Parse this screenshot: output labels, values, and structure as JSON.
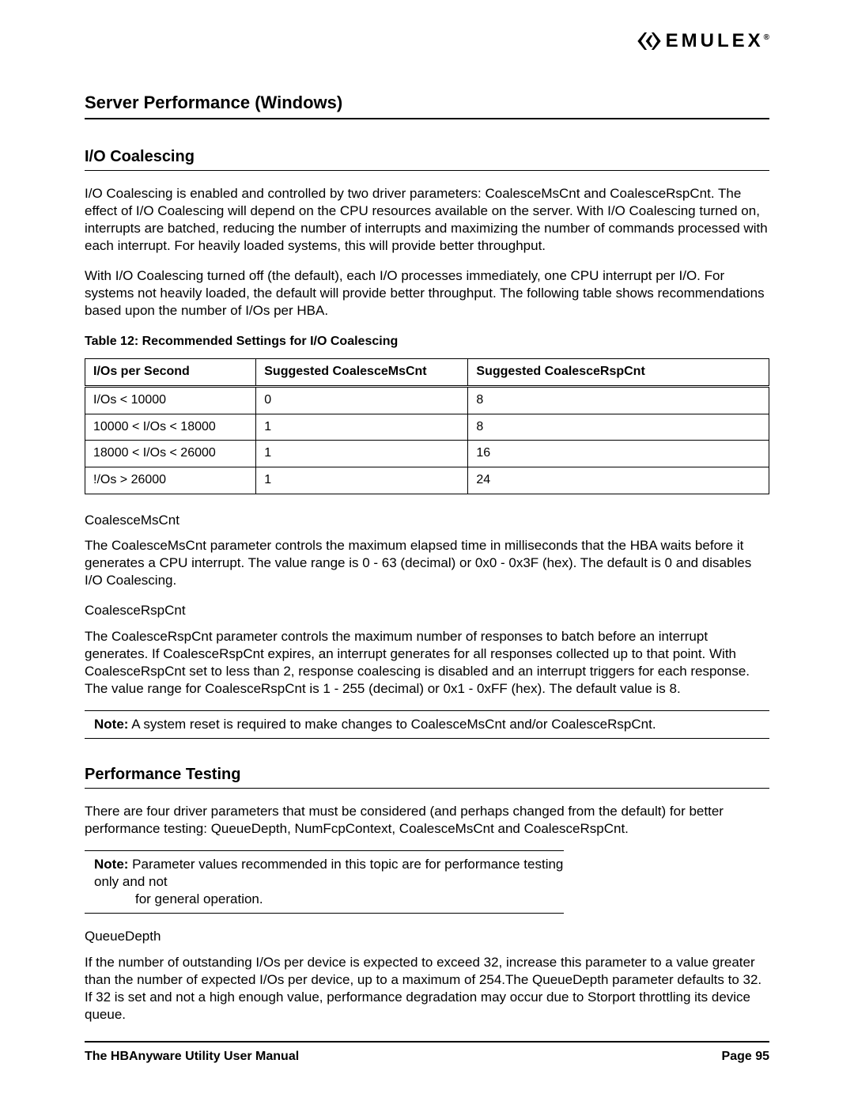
{
  "logo": {
    "text": "EMULEX",
    "sup": "®"
  },
  "h1": "Server Performance (Windows)",
  "sec1": {
    "title": "I/O Coalescing",
    "p1": "I/O Coalescing is enabled and controlled by two driver parameters: CoalesceMsCnt and CoalesceRspCnt. The effect of I/O Coalescing will depend on the CPU resources available on the server. With I/O Coalescing turned on, interrupts are batched, reducing the number of interrupts and maximizing the number of commands processed with each interrupt. For heavily loaded systems, this will provide better throughput.",
    "p2": "With I/O Coalescing turned off (the default), each I/O processes immediately, one CPU interrupt per I/O. For systems not heavily loaded, the default will provide better throughput. The following table shows recommendations based upon the number of I/Os per HBA.",
    "table_caption": "Table 12: Recommended Settings for I/O Coalescing",
    "table": {
      "headers": [
        "I/Os per Second",
        "Suggested CoalesceMsCnt",
        "Suggested CoalesceRspCnt"
      ],
      "rows": [
        [
          "I/Os < 10000",
          "0",
          "8"
        ],
        [
          "10000 < I/Os < 18000",
          "1",
          "8"
        ],
        [
          "18000 < I/Os < 26000",
          "1",
          "16"
        ],
        [
          "!/Os > 26000",
          "1",
          "24"
        ]
      ]
    },
    "sub1_h": "CoalesceMsCnt",
    "sub1_p": "The CoalesceMsCnt parameter controls the maximum elapsed time in milliseconds that the HBA waits before it generates a CPU interrupt. The value range is 0 - 63 (decimal) or 0x0 - 0x3F (hex). The default is 0 and disables I/O Coalescing.",
    "sub2_h": "CoalesceRspCnt",
    "sub2_p": "The CoalesceRspCnt parameter controls the maximum number of responses to batch before an interrupt generates. If CoalesceRspCnt expires, an interrupt generates for all responses collected up to that point. With CoalesceRspCnt set to less than 2, response coalescing is disabled and an interrupt triggers for each response. The value range for CoalesceRspCnt is 1 - 255 (decimal) or 0x1 - 0xFF (hex). The default value is 8.",
    "note1_label": "Note:",
    "note1_text": "  A system reset is required to make changes to CoalesceMsCnt and/or CoalesceRspCnt."
  },
  "sec2": {
    "title": "Performance Testing",
    "p1": "There are four driver parameters that must be considered (and perhaps changed from the default) for better performance testing: QueueDepth, NumFcpContext, CoalesceMsCnt and CoalesceRspCnt.",
    "note_label": "Note:",
    "note_line1": " Parameter values recommended in this topic are for performance testing only and not",
    "note_line2": "for general operation.",
    "sub1_h": "QueueDepth",
    "sub1_p": "If the number of outstanding I/Os per device is expected to exceed 32, increase this parameter to a value greater than the number of expected I/Os per device, up to a maximum of 254.The QueueDepth parameter defaults to 32. If 32 is set and not a high enough value, performance degradation may occur due to Storport throttling its device queue."
  },
  "footer": {
    "left": "The HBAnyware Utility User Manual",
    "right": "Page 95"
  }
}
